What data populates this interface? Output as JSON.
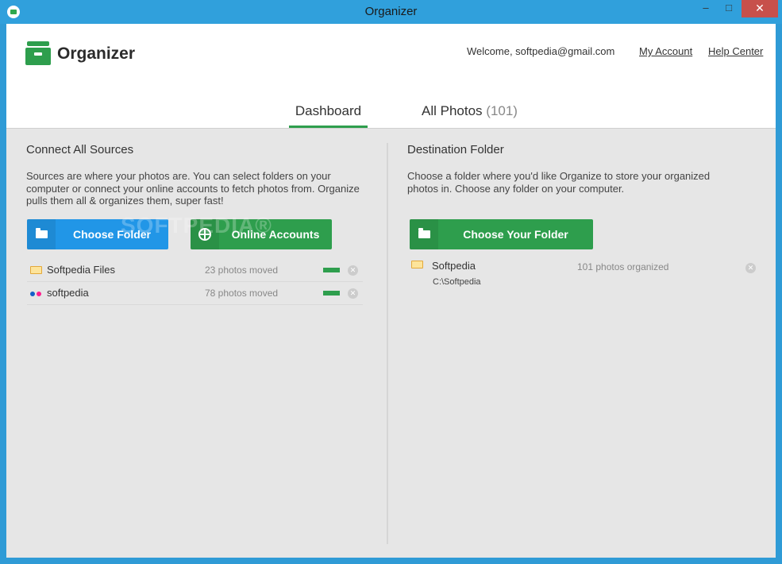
{
  "window": {
    "title": "Organizer",
    "minimize": "–",
    "maximize": "□",
    "close": "✕"
  },
  "header": {
    "brand": "Organizer",
    "welcome": "Welcome, softpedia@gmail.com",
    "my_account": "My Account",
    "help_center": "Help Center"
  },
  "tabs": [
    {
      "label": "Dashboard",
      "active": true
    },
    {
      "label": "All Photos",
      "count": "(101)",
      "active": false
    }
  ],
  "sources": {
    "title": "Connect All Sources",
    "description": "Sources are where your photos are. You can select folders on your computer or connect your online accounts to fetch photos from. Organize pulls them all & organizes them, super fast!",
    "choose_folder_label": "Choose Folder",
    "online_accounts_label": "Online Accounts",
    "items": [
      {
        "icon": "folder-icon",
        "name": "Softpedia Files",
        "status": "23 photos moved",
        "progress": 1.0
      },
      {
        "icon": "flickr-icon",
        "name": "softpedia",
        "status": "78 photos moved",
        "progress": 1.0
      }
    ]
  },
  "destination": {
    "title": "Destination Folder",
    "description": "Choose a folder where you'd like Organize to store your organized photos in. Choose any folder on your computer.",
    "choose_label": "Choose Your Folder",
    "folder": {
      "name": "Softpedia",
      "path": "C:\\Softpedia",
      "status": "101 photos organized"
    }
  },
  "watermark": "SOFTPEDIA®",
  "colors": {
    "accent_green": "#2e9e4d",
    "accent_blue": "#2196e7",
    "titlebar": "#30a0dc"
  }
}
